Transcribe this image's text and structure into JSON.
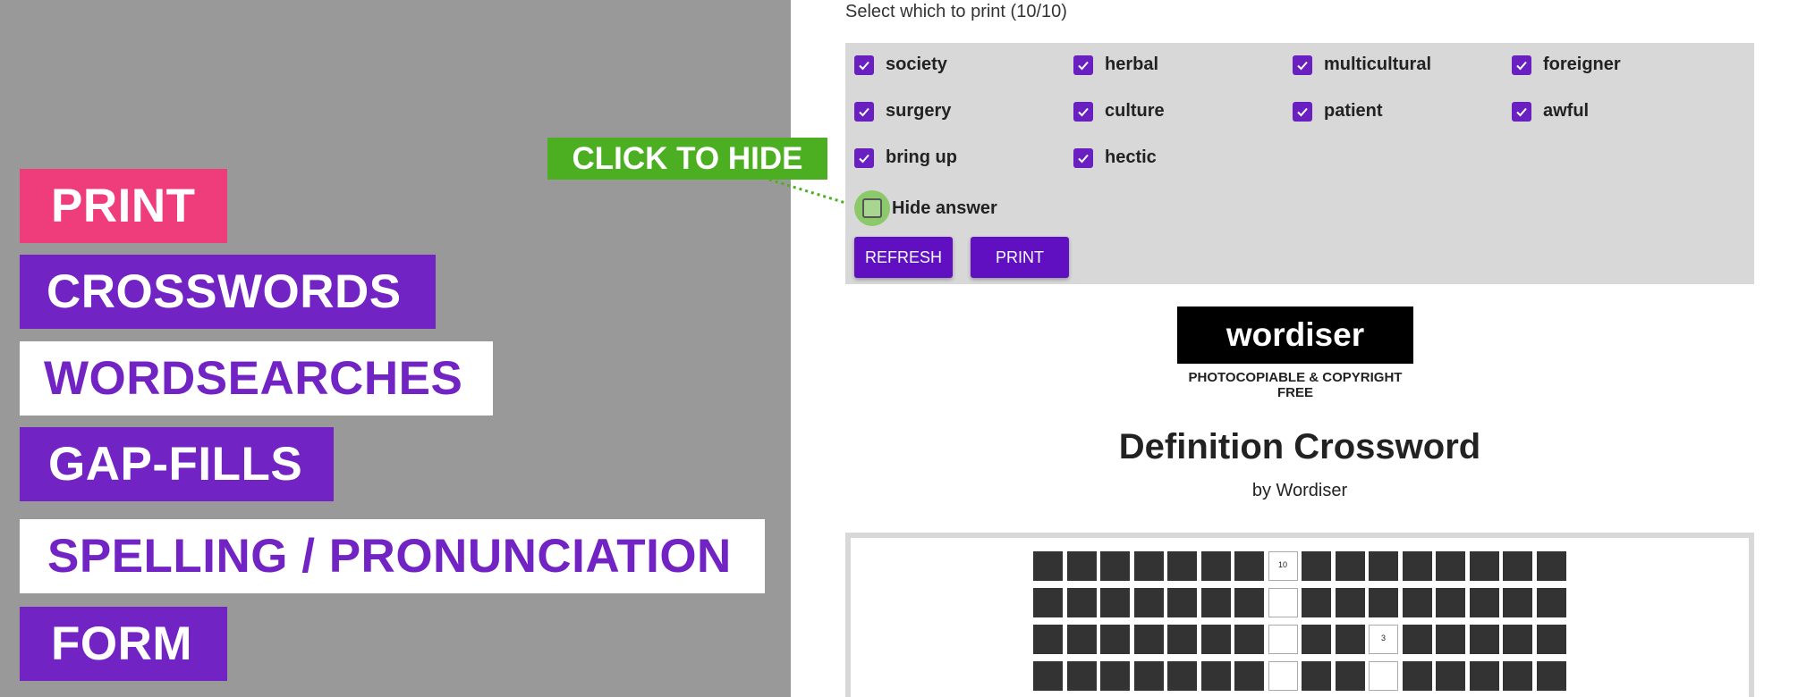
{
  "promo": {
    "print": "PRINT",
    "crosswords": "CROSSWORDS",
    "wordsearches": "WORDSEARCHES",
    "gapfills": "GAP-FILLS",
    "spelling": "SPELLING / PRONUNCIATION",
    "form": "FORM"
  },
  "callout": {
    "text": "CLICK TO HIDE"
  },
  "options": {
    "label": "Select which to print (10/10)",
    "words": [
      {
        "text": "society",
        "checked": true
      },
      {
        "text": "herbal",
        "checked": true
      },
      {
        "text": "multicultural",
        "checked": true
      },
      {
        "text": "foreigner",
        "checked": true
      },
      {
        "text": "surgery",
        "checked": true
      },
      {
        "text": "culture",
        "checked": true
      },
      {
        "text": "patient",
        "checked": true
      },
      {
        "text": "awful",
        "checked": true
      },
      {
        "text": "bring up",
        "checked": true
      },
      {
        "text": "hectic",
        "checked": true
      }
    ],
    "hide_answer": {
      "label": "Hide answer",
      "checked": false
    },
    "refresh_label": "REFRESH",
    "print_label": "PRINT"
  },
  "logo": {
    "name": "wordiser",
    "tagline": "PHOTOCOPIABLE & COPYRIGHT FREE"
  },
  "worksheet": {
    "title": "Definition Crossword",
    "author": "by Wordiser",
    "grid_rows": [
      "#######W########",
      "#######W########",
      "#######W##W#####",
      "#######W##W#####"
    ],
    "clue_numbers": [
      {
        "row": 0,
        "col": 7,
        "number": "10"
      },
      {
        "row": 2,
        "col": 10,
        "number": "3"
      }
    ]
  },
  "colors": {
    "panel_bg": "#999999",
    "pink": "#ef3d7b",
    "purple": "#7124c3",
    "green": "#4caf22",
    "button": "#6010c0"
  }
}
